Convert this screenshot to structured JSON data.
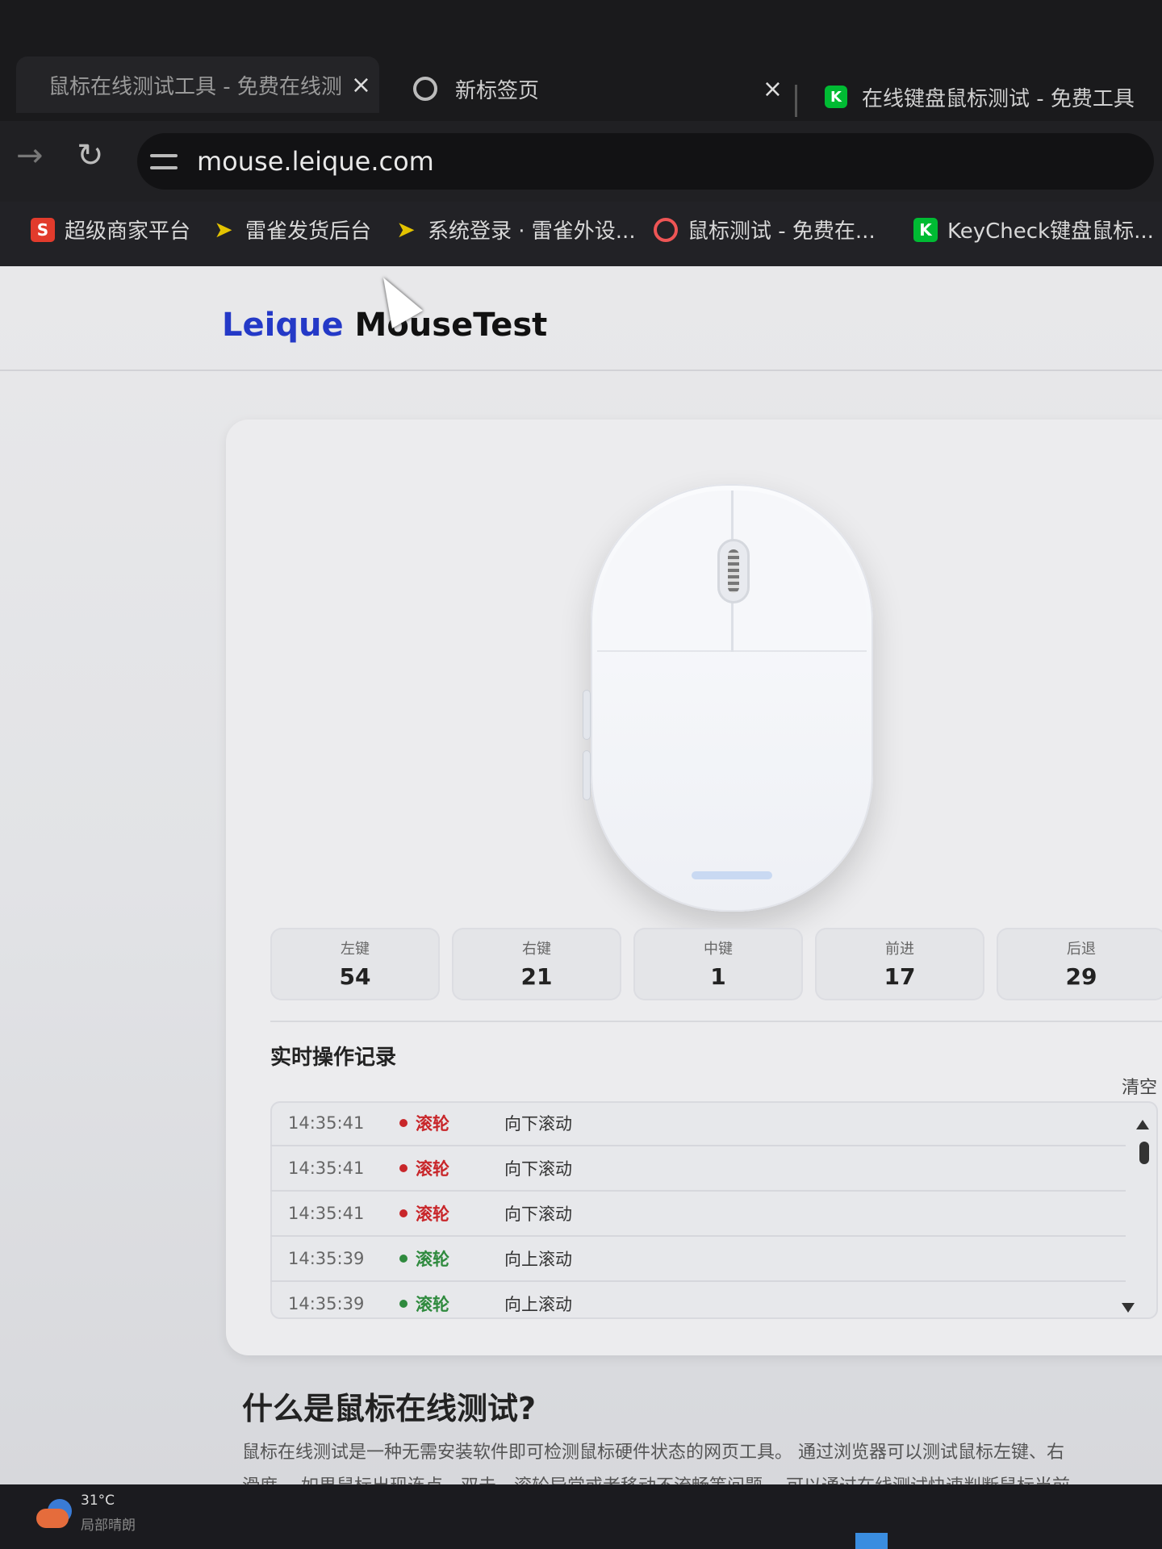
{
  "tabs": [
    {
      "title": "鼠标在线测试工具 - 免费在线测",
      "close": "×"
    },
    {
      "title": "新标签页",
      "close": "×"
    },
    {
      "title": "在线键盘鼠标测试 - 免费工具"
    }
  ],
  "toolbar": {
    "forward_icon": "→",
    "reload_icon": "↻",
    "url": "mouse.leique.com"
  },
  "bookmarks": [
    {
      "label": "超级商家平台",
      "favicon": "S"
    },
    {
      "label": "雷雀发货后台",
      "favicon": "➤"
    },
    {
      "label": "系统登录 · 雷雀外设...",
      "favicon": "➤"
    },
    {
      "label": "鼠标测试 - 免费在...",
      "favicon": ""
    },
    {
      "label": "KeyCheck键盘鼠标...",
      "favicon": "K"
    }
  ],
  "logo": {
    "part1": "Leique",
    "part2": "MouseTest"
  },
  "counters": [
    {
      "label": "左键",
      "value": "54"
    },
    {
      "label": "右键",
      "value": "21"
    },
    {
      "label": "中键",
      "value": "1"
    },
    {
      "label": "前进",
      "value": "17"
    },
    {
      "label": "后退",
      "value": "29"
    }
  ],
  "log": {
    "title": "实时操作记录",
    "clear": "清空",
    "rows": [
      {
        "time": "14:35:41",
        "type": "滚轮",
        "desc": "向下滚动",
        "dir": "down"
      },
      {
        "time": "14:35:41",
        "type": "滚轮",
        "desc": "向下滚动",
        "dir": "down"
      },
      {
        "time": "14:35:41",
        "type": "滚轮",
        "desc": "向下滚动",
        "dir": "down"
      },
      {
        "time": "14:35:39",
        "type": "滚轮",
        "desc": "向上滚动",
        "dir": "up"
      },
      {
        "time": "14:35:39",
        "type": "滚轮",
        "desc": "向上滚动",
        "dir": "up"
      }
    ]
  },
  "info": {
    "title": "什么是鼠标在线测试?",
    "line1": "鼠标在线测试是一种无需安装软件即可检测鼠标硬件状态的网页工具。 通过浏览器可以测试鼠标左键、右",
    "line2": "滑度。 如果鼠标出现连点、双击、滚轮异常或者移动不流畅等问题， 可以通过在线测试快速判断鼠标当前"
  },
  "taskbar": {
    "temp": "31°C",
    "condition": "局部晴朗"
  },
  "colors": {
    "brand_blue": "#2439c7",
    "scroll_down": "#c8262a",
    "scroll_up": "#2f8a3e"
  }
}
